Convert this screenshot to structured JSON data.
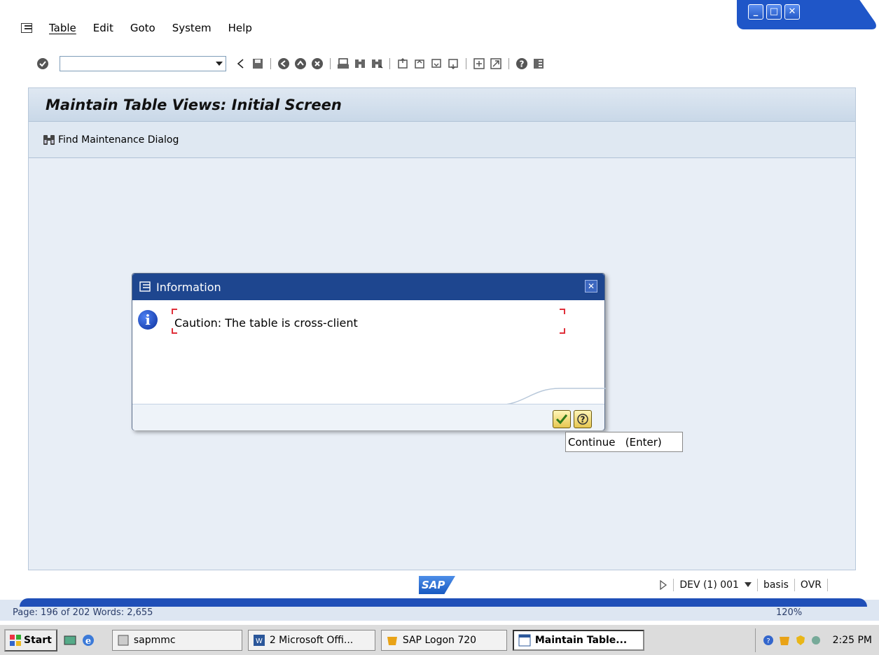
{
  "menubar": {
    "items": [
      "Table",
      "Edit",
      "Goto",
      "System",
      "Help"
    ]
  },
  "window_controls": {
    "minimize": "_",
    "maximize": "□",
    "close": "✕"
  },
  "screen": {
    "title": "Maintain Table Views: Initial Screen",
    "app_toolbar": {
      "find_label": "Find Maintenance Dialog"
    }
  },
  "dialog": {
    "title": "Information",
    "message": "Caution: The table is cross-client",
    "tooltip": "Continue   (Enter)"
  },
  "statusbar": {
    "logo": "SAP",
    "system": "DEV (1) 001",
    "user": "basis",
    "mode": "OVR"
  },
  "wordbar": {
    "status": "Page: 196 of 202    Words: 2,655",
    "zoom": "120%"
  },
  "taskbar": {
    "start": "Start",
    "tasks": [
      "sapmmc",
      "2 Microsoft Offi...",
      "SAP Logon 720",
      "Maintain Table..."
    ],
    "clock": "2:25 PM"
  },
  "colors": {
    "titlebar_blue": "#1e468f",
    "screen_bg": "#e8eef6",
    "accent_yellow": "#e7c650"
  }
}
